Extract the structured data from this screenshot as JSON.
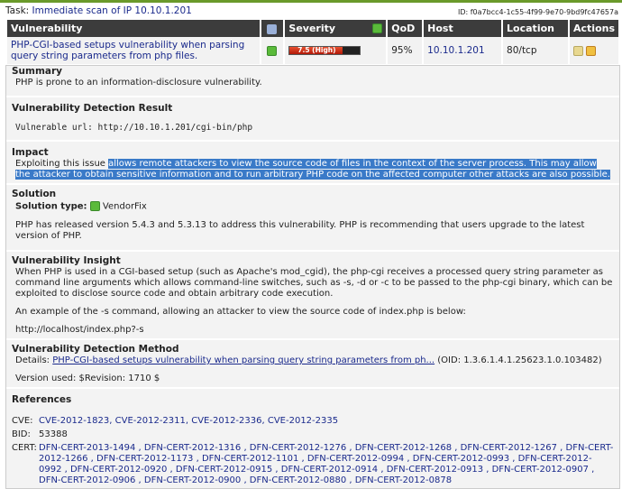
{
  "task": {
    "label": "Task:",
    "name": "Immediate scan of IP 10.10.1.201",
    "id": "ID: f0a7bcc4-1c55-4f99-9e70-9bd9fc47657a"
  },
  "table": {
    "headers": [
      "Vulnerability",
      "Severity",
      "QoD",
      "Host",
      "Location",
      "Actions"
    ],
    "row": {
      "vulnerability": "PHP-CGI-based setups vulnerability when parsing query string parameters from php files.",
      "severity_label": "7.5 (High)",
      "severity_value": 7.5,
      "severity_color": "#c82010",
      "qod": "95%",
      "host": "10.10.1.201",
      "location": "80/tcp"
    }
  },
  "details": {
    "summary": {
      "title": "Summary",
      "text": "PHP is prone to an information-disclosure vulnerability."
    },
    "detection_result": {
      "title": "Vulnerability Detection Result",
      "text": "Vulnerable url: http://10.10.1.201/cgi-bin/php"
    },
    "impact": {
      "title": "Impact",
      "text_plain": "Exploiting this issue ",
      "text_selected": "allows remote attackers to view the source code of files in the context of the server process. This may allow the attacker to obtain sensitive information and to run arbitrary PHP code on the affected computer other attacks are also possible."
    },
    "solution": {
      "title": "Solution",
      "type_label": "Solution type:",
      "type_value": "VendorFix",
      "text": "PHP has released version 5.4.3 and 5.3.13 to address this vulnerability. PHP is recommending that users upgrade to the latest version of PHP."
    },
    "insight": {
      "title": "Vulnerability Insight",
      "p1": "When PHP is used in a CGI-based setup (such as Apache's mod_cgid), the php-cgi receives a processed query string parameter as command line arguments which allows command-line switches, such as -s, -d or -c to be passed to the php-cgi binary, which can be exploited to disclose source code and obtain arbitrary code execution.",
      "p2": "An example of the -s command, allowing an attacker to view the source code of index.php is below:",
      "p3": "http://localhost/index.php?-s"
    },
    "method": {
      "title": "Vulnerability Detection Method",
      "details_label": "Details:",
      "details_link": "PHP-CGI-based setups vulnerability when parsing query string parameters from ph...",
      "oid": "(OID: 1.3.6.1.4.1.25623.1.0.103482)",
      "version": "Version used: $Revision: 1710 $"
    },
    "references": {
      "title": "References",
      "cve_label": "CVE:",
      "cve": "CVE-2012-1823, CVE-2012-2311, CVE-2012-2336, CVE-2012-2335",
      "bid_label": "BID:",
      "bid": "53388",
      "cert_label": "CERT:",
      "cert": "DFN-CERT-2013-1494 , DFN-CERT-2012-1316 , DFN-CERT-2012-1276 , DFN-CERT-2012-1268 , DFN-CERT-2012-1267 , DFN-CERT-2012-1266 , DFN-CERT-2012-1173 , DFN-CERT-2012-1101 , DFN-CERT-2012-0994 , DFN-CERT-2012-0993 , DFN-CERT-2012-0992 , DFN-CERT-2012-0920 , DFN-CERT-2012-0915 , DFN-CERT-2012-0914 , DFN-CERT-2012-0913 , DFN-CERT-2012-0907 , DFN-CERT-2012-0906 , DFN-CERT-2012-0900 , DFN-CERT-2012-0880 , DFN-CERT-2012-0878"
    }
  }
}
